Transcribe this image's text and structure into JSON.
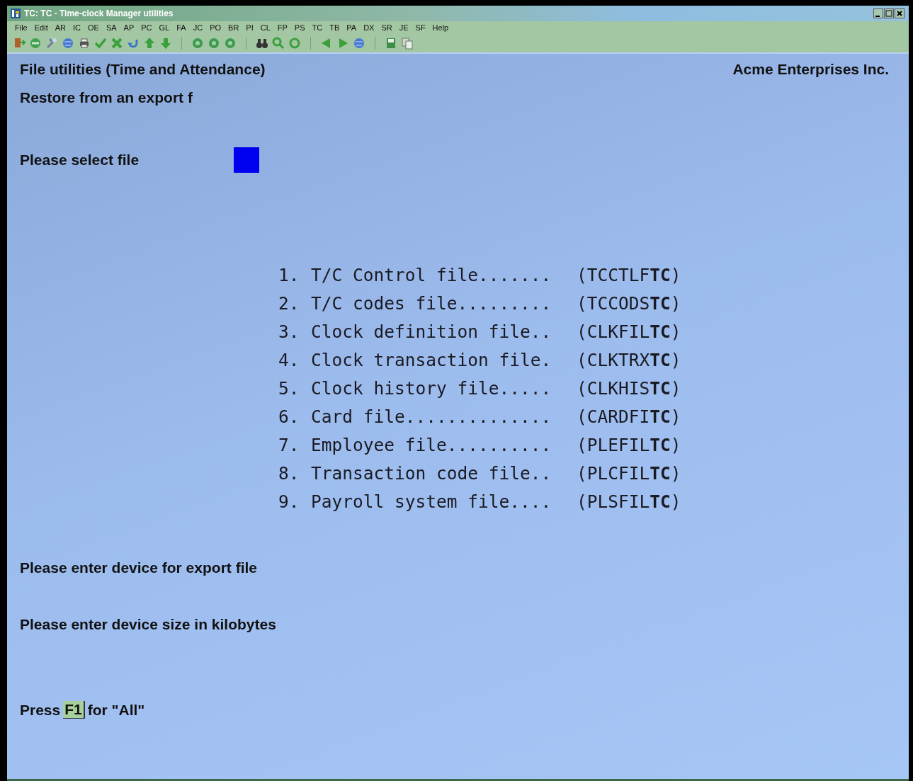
{
  "window": {
    "title": "TC: TC - Time-clock Manager utilities"
  },
  "menu": [
    "File",
    "Edit",
    "AR",
    "IC",
    "OE",
    "SA",
    "AP",
    "PC",
    "GL",
    "FA",
    "JC",
    "PO",
    "BR",
    "PI",
    "CL",
    "FP",
    "PS",
    "TC",
    "TB",
    "PA",
    "DX",
    "SR",
    "JE",
    "SF",
    "Help"
  ],
  "screen": {
    "heading": "File utilities (Time and Attendance)",
    "company": "Acme Enterprises Inc.",
    "subheading": "Restore from an export f",
    "select_label": "Please select file",
    "files": [
      {
        "number": "1.",
        "name": "T/C Control file.......",
        "code": "(TCCTLF**TC**)"
      },
      {
        "number": "2.",
        "name": "T/C codes file.........",
        "code": "(TCCODS**TC**)"
      },
      {
        "number": "3.",
        "name": "Clock definition file..",
        "code": "(CLKFIL**TC**)"
      },
      {
        "number": "4.",
        "name": "Clock transaction file.",
        "code": "(CLKTRX**TC**)"
      },
      {
        "number": "5.",
        "name": "Clock history file.....",
        "code": "(CLKHIS**TC**)"
      },
      {
        "number": "6.",
        "name": "Card file..............",
        "code": "(CARDFI**TC**)"
      },
      {
        "number": "7.",
        "name": "Employee file..........",
        "code": "(PLEFIL**TC**)"
      },
      {
        "number": "8.",
        "name": "Transaction code file..",
        "code": "(PLCFIL**TC**)"
      },
      {
        "number": "9.",
        "name": "Payroll system file....",
        "code": "(PLSFIL**TC**)"
      }
    ],
    "device_label": "Please enter device for export file",
    "size_label": "Please enter device size in kilobytes",
    "hint": {
      "before": "Press",
      "key": "F1",
      "after": "for \"All\""
    }
  }
}
